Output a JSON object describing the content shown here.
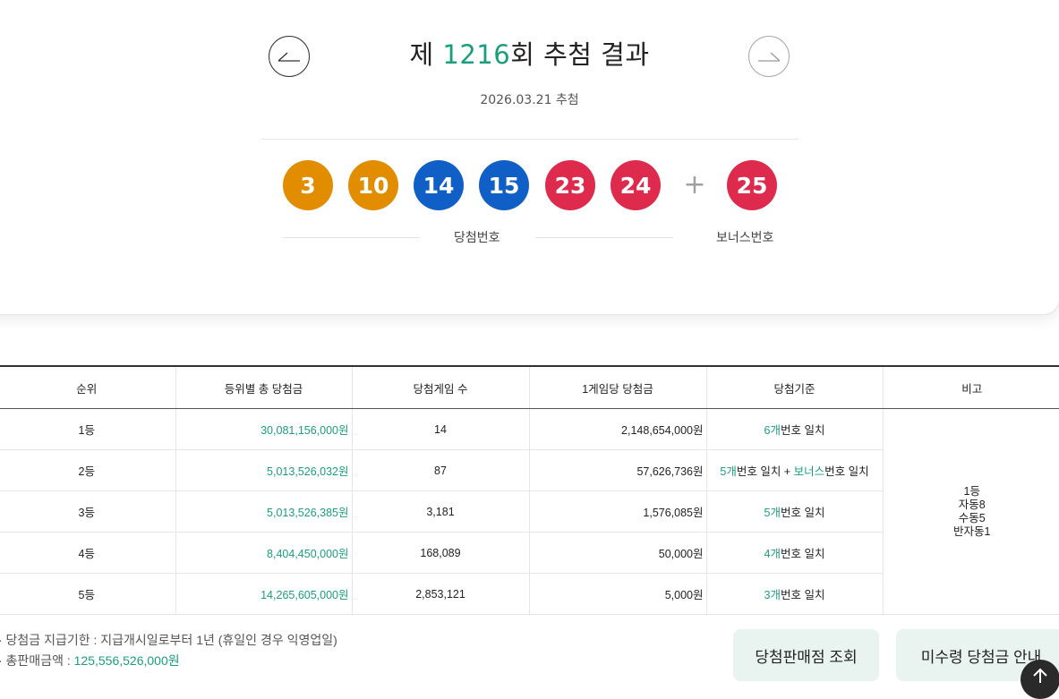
{
  "header": {
    "title_prefix": "제 ",
    "round_number": "1216",
    "title_suffix": "회 추첨 결과",
    "draw_date": "2026.03.21 추첨",
    "prev_icon": "arrow-left-icon",
    "next_icon": "arrow-right-icon"
  },
  "balls": [
    {
      "number": "3",
      "color": "#e28c00"
    },
    {
      "number": "10",
      "color": "#e28c00"
    },
    {
      "number": "14",
      "color": "#0f5fc6"
    },
    {
      "number": "15",
      "color": "#0f5fc6"
    },
    {
      "number": "23",
      "color": "#de2a4d"
    },
    {
      "number": "24",
      "color": "#de2a4d"
    }
  ],
  "plus_sign": "+",
  "bonus_ball": {
    "number": "25",
    "color": "#de2a4d"
  },
  "labels": {
    "winning": "당첨번호",
    "bonus": "보너스번호"
  },
  "table": {
    "headers": [
      "순위",
      "등위별 총 당첨금",
      "당첨게임 수",
      "1게임당 당첨금",
      "당첨기준",
      "비고"
    ],
    "rows": [
      {
        "rank": "1등",
        "total": "30,081,156,000원",
        "games": "14",
        "per_game": "2,148,654,000원",
        "crit_count": "6개",
        "crit_mid": "번호 일치",
        "crit_bonus": "",
        "crit_end": ""
      },
      {
        "rank": "2등",
        "total": "5,013,526,032원",
        "games": "87",
        "per_game": "57,626,736원",
        "crit_count": "5개",
        "crit_mid": "번호 일치 + ",
        "crit_bonus": "보너스",
        "crit_end": "번호 일치"
      },
      {
        "rank": "3등",
        "total": "5,013,526,385원",
        "games": "3,181",
        "per_game": "1,576,085원",
        "crit_count": "5개",
        "crit_mid": "번호 일치",
        "crit_bonus": "",
        "crit_end": ""
      },
      {
        "rank": "4등",
        "total": "8,404,450,000원",
        "games": "168,089",
        "per_game": "50,000원",
        "crit_count": "4개",
        "crit_mid": "번호 일치",
        "crit_bonus": "",
        "crit_end": ""
      },
      {
        "rank": "5등",
        "total": "14,265,605,000원",
        "games": "2,853,121",
        "per_game": "5,000원",
        "crit_count": "3개",
        "crit_mid": "번호 일치",
        "crit_bonus": "",
        "crit_end": ""
      }
    ],
    "note": "1등\n자동8\n수동5\n반자동1"
  },
  "footer": {
    "note1": "·  당첨금 지급기한 : 지급개시일로부터 1년 (휴일인 경우 익영업일)",
    "note2_label": "·  총판매금액 : ",
    "note2_value": "125,556,526,000원",
    "btn_stores": "당첨판매점 조회",
    "btn_unclaimed": "미수령 당첨금 안내"
  }
}
